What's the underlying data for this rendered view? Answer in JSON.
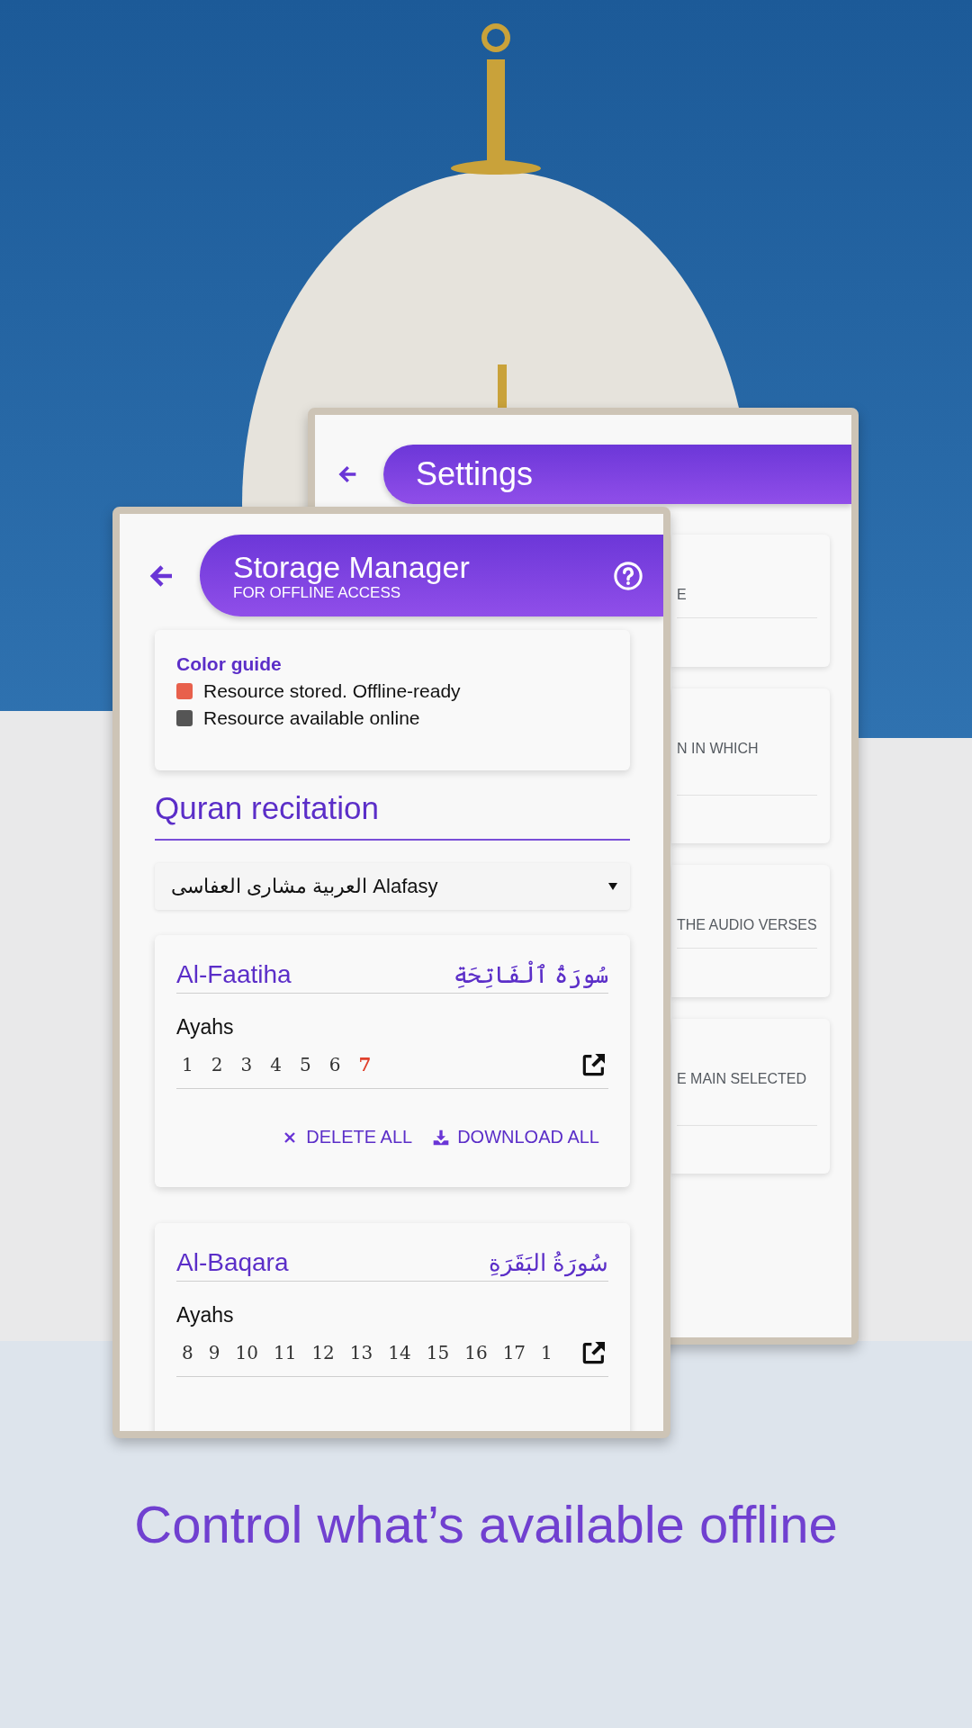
{
  "settings_screen": {
    "title": "Settings",
    "cards": [
      {
        "text": "E"
      },
      {
        "text": "N IN WHICH"
      },
      {
        "text": "THE AUDIO VERSES"
      },
      {
        "text": "E MAIN SELECTED"
      }
    ]
  },
  "storage_screen": {
    "title": "Storage Manager",
    "subtitle": "FOR OFFLINE ACCESS",
    "color_guide": {
      "title": "Color guide",
      "items": [
        {
          "label": "Resource stored. Offline-ready",
          "color": "#e8604c"
        },
        {
          "label": "Resource available online",
          "color": "#555555"
        }
      ]
    },
    "section_title": "Quran recitation",
    "reciter_select": {
      "value": "العربية مشارى العفاسى Alafasy"
    },
    "surahs": [
      {
        "name": "Al-Faatiha",
        "arabic_name": "سُورَةُ ٱلْفَاتِحَةِ",
        "ayahs_label": "Ayahs",
        "ayahs": [
          {
            "number": "1",
            "stored": false
          },
          {
            "number": "2",
            "stored": false
          },
          {
            "number": "3",
            "stored": false
          },
          {
            "number": "4",
            "stored": false
          },
          {
            "number": "5",
            "stored": false
          },
          {
            "number": "6",
            "stored": false
          },
          {
            "number": "7",
            "stored": true
          }
        ],
        "actions": [
          {
            "label": "DELETE ALL",
            "kind": "delete"
          },
          {
            "label": "DOWNLOAD ALL",
            "kind": "download"
          }
        ]
      },
      {
        "name": "Al-Baqara",
        "arabic_name": "سُورَةُ البَقَرَةِ",
        "ayahs_label": "Ayahs",
        "ayahs": [
          {
            "number": "8",
            "stored": false
          },
          {
            "number": "9",
            "stored": false
          },
          {
            "number": "10",
            "stored": false
          },
          {
            "number": "11",
            "stored": false
          },
          {
            "number": "12",
            "stored": false
          },
          {
            "number": "13",
            "stored": false
          },
          {
            "number": "14",
            "stored": false
          },
          {
            "number": "15",
            "stored": false
          },
          {
            "number": "16",
            "stored": false
          },
          {
            "number": "17",
            "stored": false
          },
          {
            "number": "1",
            "stored": false
          }
        ]
      }
    ]
  },
  "caption": "Control what’s available offline"
}
